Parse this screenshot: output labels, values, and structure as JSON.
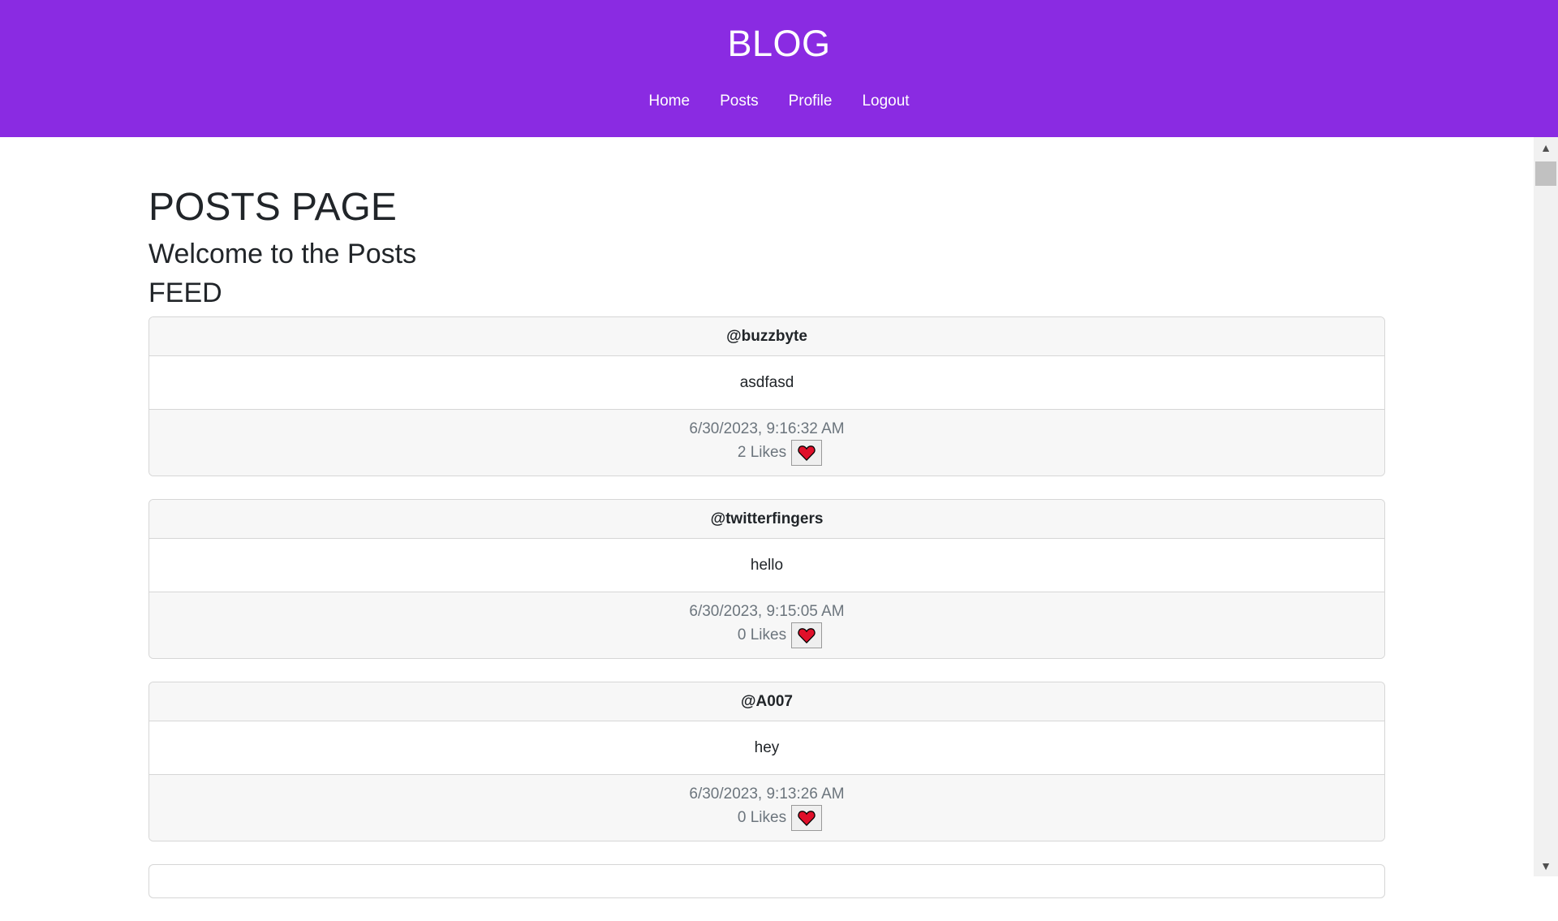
{
  "header": {
    "brand": "BLOG",
    "nav": [
      {
        "label": "Home"
      },
      {
        "label": "Posts"
      },
      {
        "label": "Profile"
      },
      {
        "label": "Logout"
      }
    ]
  },
  "page": {
    "title": "POSTS PAGE",
    "subtitle": "Welcome to the Posts",
    "feed_label": "FEED"
  },
  "posts": [
    {
      "user": "@buzzbyte",
      "body": "asdfasd",
      "timestamp": "6/30/2023, 9:16:32 AM",
      "likes": "2 Likes",
      "like_icon": "heart-icon"
    },
    {
      "user": "@twitterfingers",
      "body": "hello",
      "timestamp": "6/30/2023, 9:15:05 AM",
      "likes": "0 Likes",
      "like_icon": "heart-icon"
    },
    {
      "user": "@A007",
      "body": "hey",
      "timestamp": "6/30/2023, 9:13:26 AM",
      "likes": "0 Likes",
      "like_icon": "heart-icon"
    }
  ],
  "colors": {
    "header_bg": "#8a2be2",
    "heart": "#e0102a"
  }
}
